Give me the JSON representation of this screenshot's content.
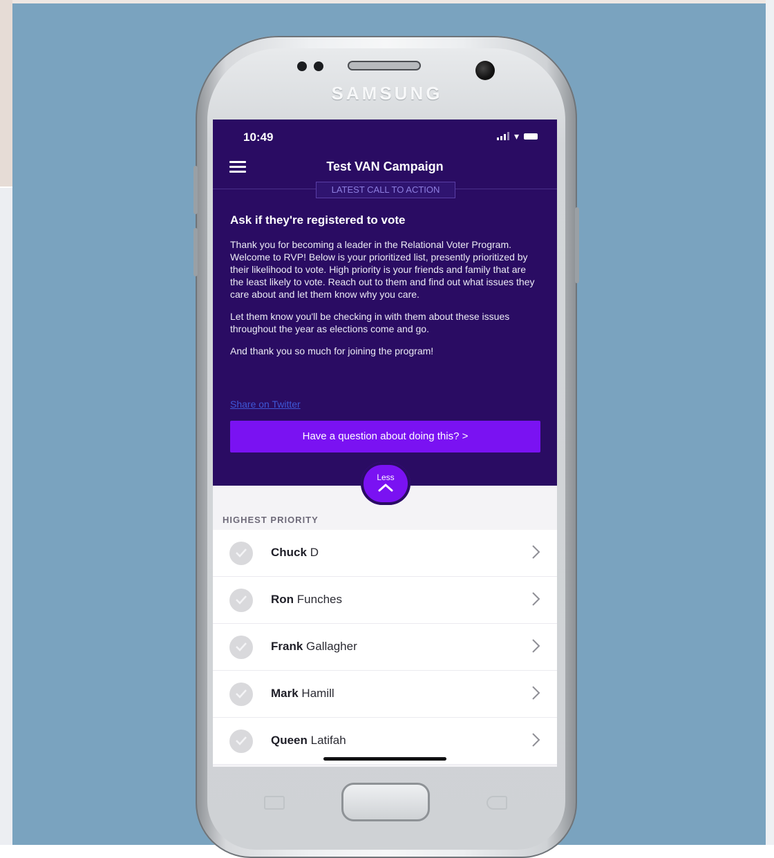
{
  "device": {
    "brand": "SAMSUNG"
  },
  "status_bar": {
    "time": "10:49"
  },
  "app": {
    "title": "Test VAN Campaign"
  },
  "call_to_action": {
    "tag": "LATEST CALL TO ACTION",
    "heading": "Ask if they're registered to vote",
    "paragraphs": [
      "Thank you for becoming a leader in the Relational Voter Program.  Welcome to RVP!  Below is your prioritized list, presently prioritized by their likelihood to vote.  High priority is your friends and family that are the least likely to vote.  Reach out to them and find out what issues they care about and let them know why you care.",
      "Let them know you'll be checking in with them about these issues throughout the year as elections come and go.",
      "And thank you so much for joining the program!"
    ],
    "share_link": "Share on Twitter",
    "question_button": "Have a question about doing this? >"
  },
  "less_button": {
    "label": "Less"
  },
  "list_section": {
    "label": "HIGHEST PRIORITY",
    "contacts": [
      {
        "first": "Chuck",
        "last": "D"
      },
      {
        "first": "Ron",
        "last": "Funches"
      },
      {
        "first": "Frank",
        "last": "Gallagher"
      },
      {
        "first": "Mark",
        "last": "Hamill"
      },
      {
        "first": "Queen",
        "last": "Latifah"
      }
    ]
  },
  "colors": {
    "header_bg": "#2a0c63",
    "accent": "#7a12f2",
    "page_bg": "#7aa3bf"
  }
}
